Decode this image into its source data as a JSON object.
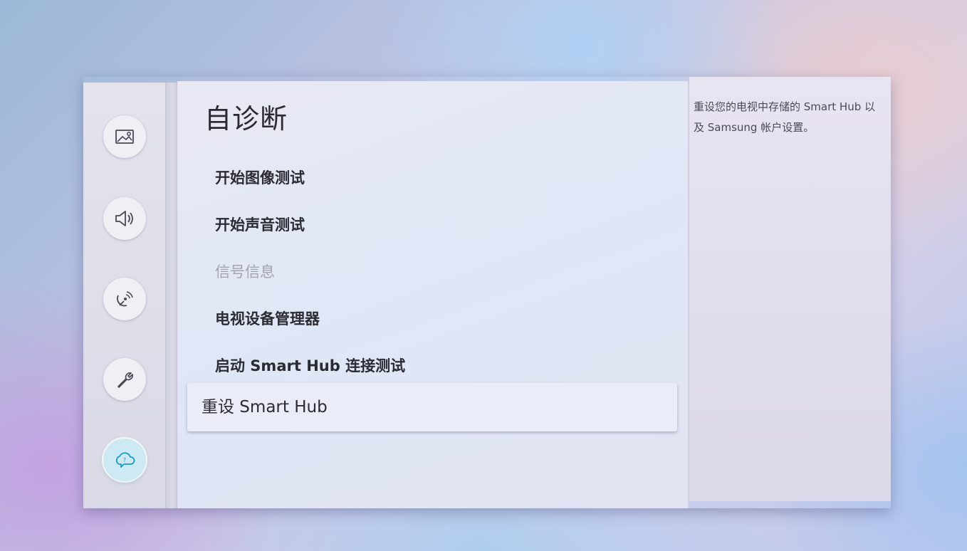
{
  "page": {
    "title": "自诊断"
  },
  "sidebar": {
    "items": [
      {
        "icon": "picture-icon",
        "active": false
      },
      {
        "icon": "sound-icon",
        "active": false
      },
      {
        "icon": "broadcast-icon",
        "active": false
      },
      {
        "icon": "wrench-icon",
        "active": false
      },
      {
        "icon": "support-cloud-icon",
        "active": true
      }
    ]
  },
  "menu": {
    "items": [
      {
        "label": "开始图像测试",
        "enabled": true
      },
      {
        "label": "开始声音测试",
        "enabled": true
      },
      {
        "label": "信号信息",
        "enabled": false
      },
      {
        "label": "电视设备管理器",
        "enabled": true
      },
      {
        "label": "启动 Smart Hub 连接测试",
        "enabled": true
      },
      {
        "label": "重设 Smart Hub",
        "enabled": true,
        "selected": true
      }
    ]
  },
  "description": {
    "text": "重设您的电视中存储的 Smart Hub 以及 Samsung 帐户设置。"
  },
  "colors": {
    "active_icon_bg": "#cdeaf4",
    "active_icon_stroke": "#1a9cc0",
    "text_primary": "#2b2b33",
    "text_disabled": "#a4a4ae"
  }
}
